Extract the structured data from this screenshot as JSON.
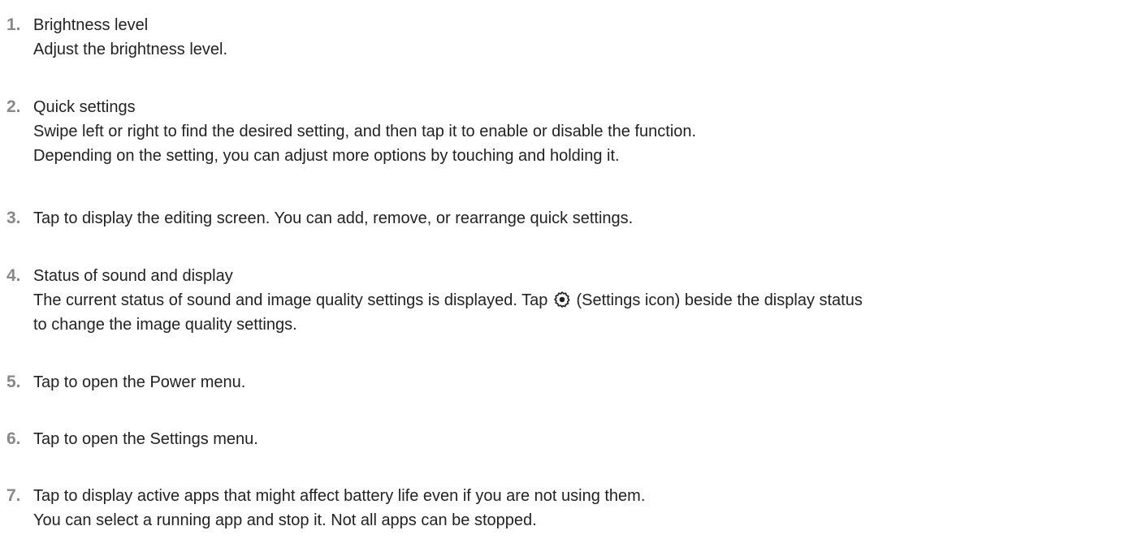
{
  "items": [
    {
      "number": "1.",
      "title": "Brightness level",
      "lines": [
        "Adjust the brightness level."
      ]
    },
    {
      "number": "2.",
      "title": "Quick settings",
      "lines": [
        "Swipe left or right to find the desired setting, and then tap it to enable or disable the function.",
        "Depending on the setting, you can adjust more options by touching and holding it."
      ]
    },
    {
      "number": "3.",
      "title": "Tap to display the editing screen. You can add, remove, or rearrange quick settings."
    },
    {
      "number": "4.",
      "title": "Status of sound and display",
      "line1_before_icon": "The current status of sound and image quality settings is displayed. Tap ",
      "line1_after_icon": " (Settings icon) beside the display status",
      "line2": "to change the image quality settings.",
      "icon": "settings-gear-icon"
    },
    {
      "number": "5.",
      "title": "Tap to open the Power menu."
    },
    {
      "number": "6.",
      "title": "Tap to open the Settings menu."
    },
    {
      "number": "7.",
      "title": "Tap to display active apps that might affect battery life even if you are not using them.",
      "lines": [
        "You can select a running app and stop it. Not all apps can be stopped."
      ]
    }
  ],
  "colors": {
    "text": "#222222",
    "number": "#888888"
  }
}
